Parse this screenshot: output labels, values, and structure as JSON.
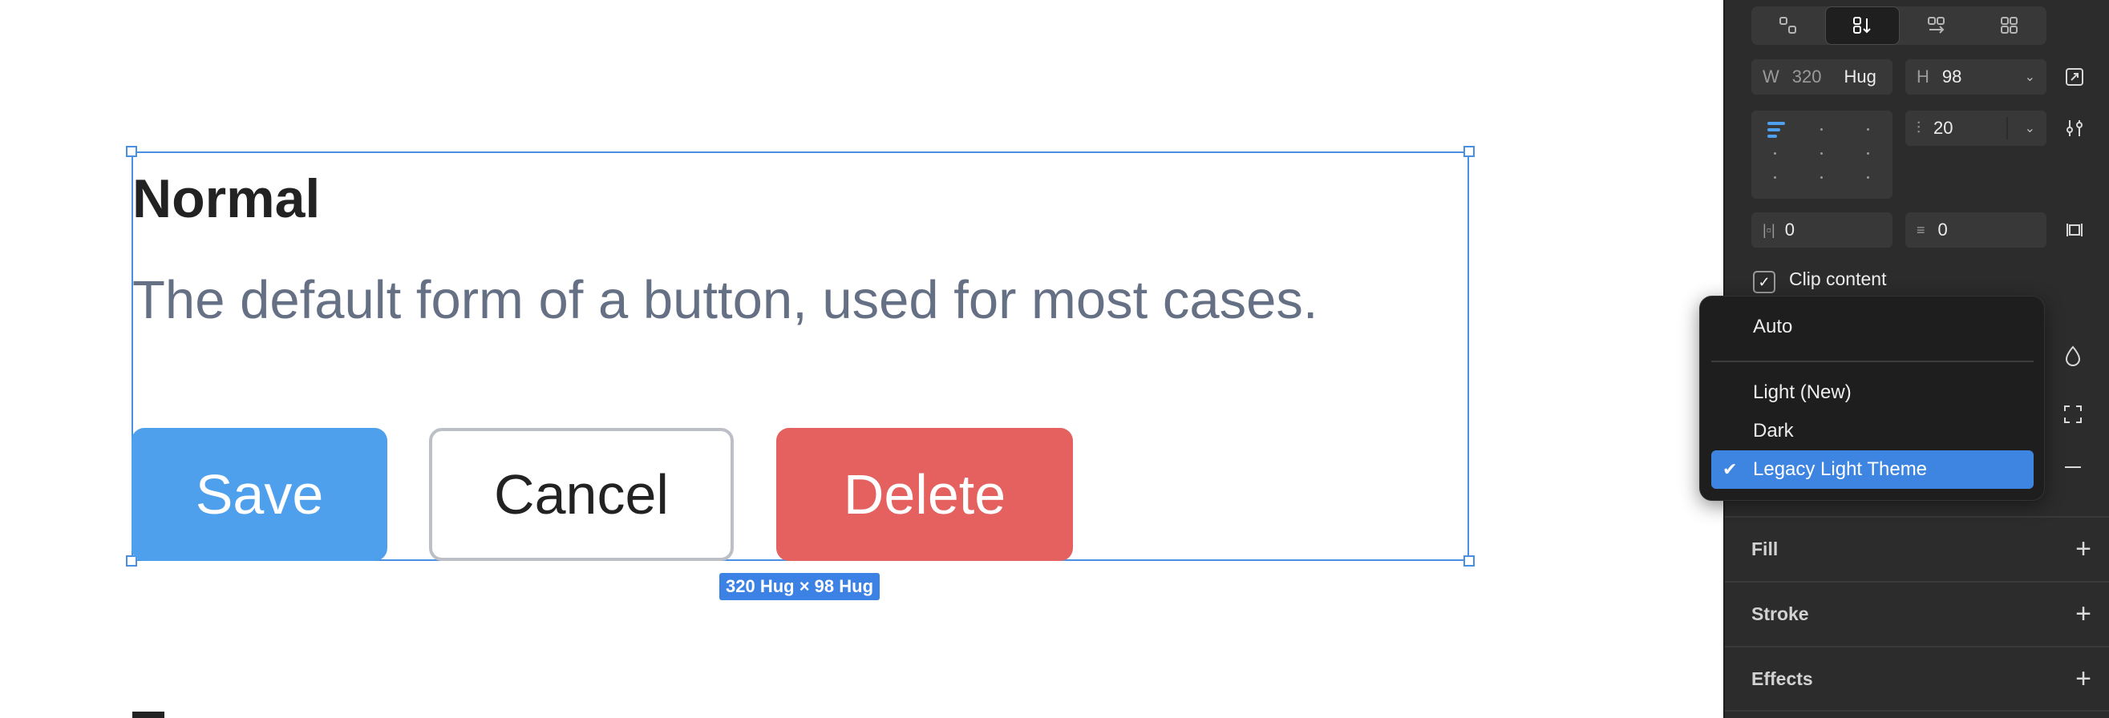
{
  "canvas": {
    "heading": "Normal",
    "description": "The default form of a button, used for most cases.",
    "buttons": {
      "save": "Save",
      "cancel": "Cancel",
      "delete": "Delete"
    },
    "size_tag": "320 Hug × 98 Hug"
  },
  "panel": {
    "width_label": "W",
    "width_value": "320",
    "width_mode": "Hug",
    "height_label": "H",
    "height_value": "98",
    "gap_value": "20",
    "padding_h": "0",
    "padding_v": "0",
    "clip_content": "Clip content",
    "sections": {
      "fill": "Fill",
      "stroke": "Stroke",
      "effects": "Effects"
    }
  },
  "dropdown": {
    "items": [
      "Auto",
      "Light (New)",
      "Dark",
      "Legacy Light Theme"
    ],
    "selected": "Legacy Light Theme"
  },
  "colors": {
    "accent": "#4a90e2",
    "save_btn": "#4fa0ec",
    "delete_btn": "#e4615f",
    "panel_bg": "#2c2c2c",
    "selected_item": "#3d85e0"
  }
}
